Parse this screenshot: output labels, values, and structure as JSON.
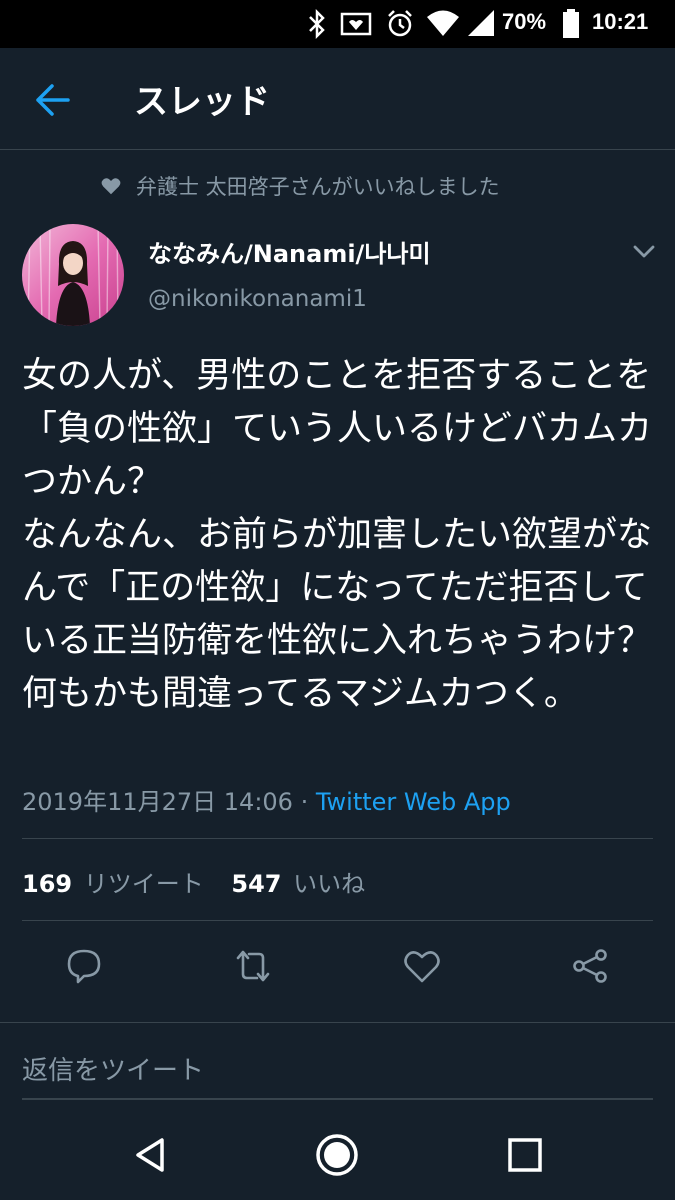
{
  "status_bar": {
    "battery_percent": "70%",
    "time": "10:21",
    "icons": [
      "bluetooth-icon",
      "nfc-icon",
      "alarm-icon",
      "wifi-icon",
      "battery-icon"
    ]
  },
  "header": {
    "title": "スレッド",
    "back_icon": "back-arrow-icon"
  },
  "liked_by": {
    "icon": "heart-icon",
    "text": "弁護士 太田啓子さんがいいねしました"
  },
  "tweet": {
    "author": {
      "display_name": "ななみん/Nanami/나나미",
      "handle": "@nikonikonanami1"
    },
    "text": "女の人が、男性のことを拒否することを「負の性欲」ていう人いるけどバカムカつかん？\nなんなん、お前らが加害したい欲望がなんで「正の性欲」になってただ拒否している正当防衛を性欲に入れちゃうわけ？何もかも間違ってるマジムカつく。",
    "timestamp": "2019年11月27日 14:06",
    "separator": " · ",
    "source": "Twitter Web App",
    "retweet_count": "169",
    "retweet_label": "リツイート",
    "like_count": "547",
    "like_label": "いいね"
  },
  "actions": [
    "reply-icon",
    "retweet-icon",
    "like-icon",
    "share-icon"
  ],
  "reply": {
    "placeholder": "返信をツイート"
  },
  "nav_bar": {
    "buttons": [
      "back-triangle-icon",
      "home-circle-icon",
      "recents-square-icon"
    ]
  },
  "colors": {
    "background": "#15202b",
    "secondary_text": "#8899a6",
    "accent": "#1da1f2",
    "divider": "#38444d"
  }
}
